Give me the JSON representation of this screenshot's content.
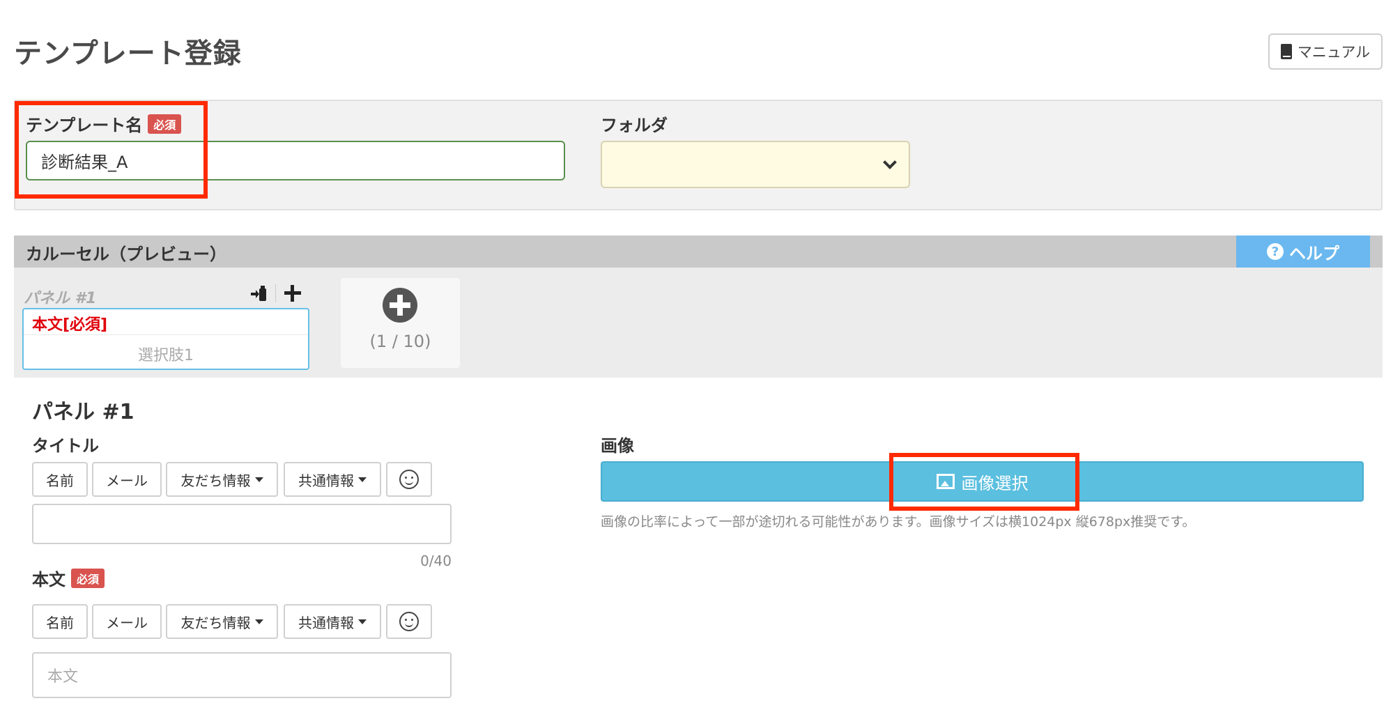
{
  "page": {
    "title": "テンプレート登録",
    "manual_button": "マニュアル"
  },
  "template_form": {
    "name_label": "テンプレート名",
    "required_badge": "必須",
    "name_value": "診断結果_A",
    "folder_label": "フォルダ",
    "folder_value": ""
  },
  "carousel": {
    "header": "カルーセル（プレビュー）",
    "help_button": "ヘルプ",
    "panel_tab_label": "パネル #1",
    "panel_card_title": "本文[必須]",
    "panel_card_choice": "選択肢1",
    "panel_count": "(1 / 10)"
  },
  "panel_editor": {
    "title": "パネル #1",
    "title_label": "タイトル",
    "toolbar": {
      "name": "名前",
      "email": "メール",
      "friend_info": "友だち情報",
      "common_info": "共通情報"
    },
    "title_input_value": "",
    "title_counter": "0/40",
    "body_label": "本文",
    "required_badge": "必須",
    "body_placeholder": "本文",
    "image_label": "画像",
    "image_button": "画像選択",
    "image_note": "画像の比率によって一部が途切れる可能性があります。画像サイズは横1024px 縦678px推奨です。"
  },
  "colors": {
    "highlight": "#ff2a00",
    "help_button": "#6ab8ef",
    "image_button": "#5bbfdf",
    "required_badge": "#d9534f",
    "folder_select_bg": "#fffbe3"
  }
}
